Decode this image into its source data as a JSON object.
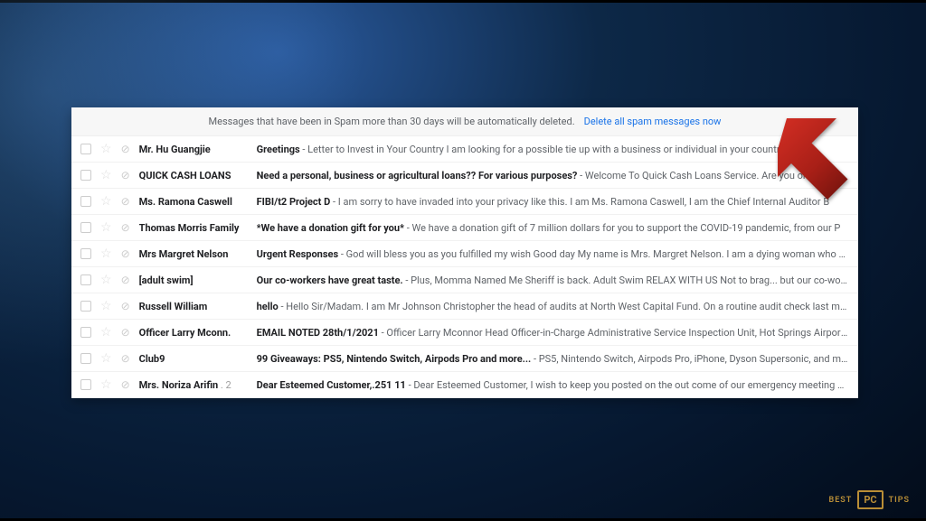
{
  "banner": {
    "text": "Messages that have been in Spam more than 30 days will be automatically deleted.",
    "link": "Delete all spam messages now"
  },
  "emails": [
    {
      "sender": "Mr. Hu Guangjie",
      "subject": "Greetings",
      "preview": " - Letter to Invest in Your Country I am looking for a possible tie up with a business or individual in your country so"
    },
    {
      "sender": "QUICK CASH LOANS",
      "subject": "Need a personal, business or agricultural loans?? For various purposes?",
      "preview": " - Welcome To Quick Cash Loans Service. Are you          oney to p"
    },
    {
      "sender": "Ms. Ramona Caswell",
      "subject": "FIBI/t2 Project D",
      "preview": " - I am sorry to have invaded into your privacy like this. I am Ms. Ramona Caswell, I am the Chief Internal Auditor B"
    },
    {
      "sender": "Thomas Morris Family",
      "subject": "*We have a donation gift for you*",
      "preview": " - We have a donation gift of 7 million dollars for you to support the COVID-19 pandemic, from our P"
    },
    {
      "sender": "Mrs Margret Nelson",
      "subject": "Urgent Responses",
      "preview": " - God will bless you as you fulfilled my wish Good day My name is Mrs. Margret Nelson. I am a dying woman who has decided t"
    },
    {
      "sender": "[adult swim]",
      "subject": "Our co-workers have great taste.",
      "preview": " - Plus, Momma Named Me Sheriff is back. Adult Swim RELAX WITH US Not to brag... but our co-workers have gr"
    },
    {
      "sender": "Russell William",
      "subject": "hello",
      "preview": " - Hello Sir/Madam. I am Mr Johnson Christopher the head of audits at North West Capital Fund. On a routine audit check last month, my part"
    },
    {
      "sender": "Officer Larry Mconn.",
      "subject": "EMAIL NOTED 28th/1/2021",
      "preview": " - Officer Larry Mconnor Head Officer-in-Charge Administrative Service Inspection Unit, Hot Springs Airport MONTANA"
    },
    {
      "sender": "Club9",
      "subject": "99 Giveaways: PS5, Nintendo Switch, Airpods Pro and more...",
      "preview": " - PS5, Nintendo Switch, Airpods Pro, iPhone, Dyson Supersonic, and many more. W"
    },
    {
      "sender": "Mrs. Noriza Arifin",
      "sender_suffix": " . 2",
      "subject": "Dear Esteemed Customer,.251 11",
      "preview": " - Dear Esteemed Customer, I wish to keep you posted on the out come of our emergency meeting with the Worl"
    }
  ],
  "watermark": {
    "left": "BEST",
    "box": "PC",
    "right": "TIPS"
  }
}
